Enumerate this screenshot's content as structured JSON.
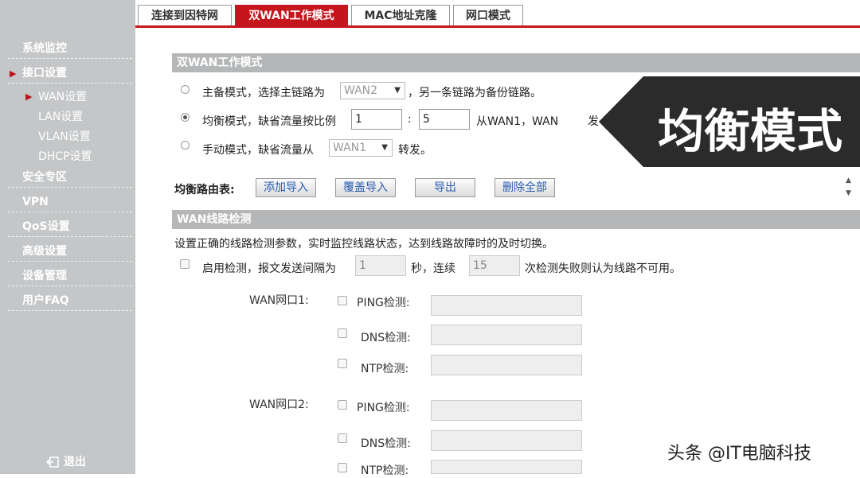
{
  "tabs": [
    {
      "label": "连接到因特网"
    },
    {
      "label": "双WAN工作模式"
    },
    {
      "label": "MAC地址克隆"
    },
    {
      "label": "网口模式"
    }
  ],
  "sidebar": {
    "items": [
      {
        "label": "系统监控"
      },
      {
        "label": "接口设置"
      },
      {
        "label": "安全专区"
      },
      {
        "label": "VPN"
      },
      {
        "label": "QoS设置"
      },
      {
        "label": "高级设置"
      },
      {
        "label": "设备管理"
      },
      {
        "label": "用户FAQ"
      }
    ],
    "subitems": [
      {
        "label": "WAN设置"
      },
      {
        "label": "LAN设置"
      },
      {
        "label": "VLAN设置"
      },
      {
        "label": "DHCP设置"
      }
    ],
    "logout": "退出"
  },
  "dual_wan": {
    "section_title": "双WAN工作模式",
    "primary_mode": {
      "prefix": "主备模式，选择主链路为",
      "select_value": "WAN2",
      "suffix": "，另一条链路为备份链路。"
    },
    "balance_mode": {
      "prefix": "均衡模式，缺省流量按比例",
      "ratio_a": "1",
      "colon": ":",
      "ratio_b": "5",
      "suffix_a": "从WAN1，WAN",
      "suffix_b": "发"
    },
    "manual_mode": {
      "prefix": "手动模式，缺省流量从",
      "select_value": "WAN1",
      "suffix": "转发。"
    },
    "route_table_label": "均衡路由表:",
    "buttons": {
      "add_import": "添加导入",
      "overwrite_import": "覆盖导入",
      "export": "导出",
      "delete_all": "删除全部"
    }
  },
  "detect": {
    "section_title": "WAN线路检测",
    "description": "设置正确的线路检测参数，实时监控线路状态，达到线路故障时的及时切换。",
    "enable": {
      "prefix": "启用检测，报文发送间隔为",
      "interval": "1",
      "mid": "秒，连续",
      "count": "15",
      "suffix": "次检测失败则认为线路不可用。"
    },
    "wan1": {
      "label": "WAN网口1:",
      "ping": "PING检测:",
      "dns": "DNS检测:",
      "ntp": "NTP检测:"
    },
    "wan2": {
      "label": "WAN网口2:",
      "ping": "PING检测:",
      "dns": "DNS检测:",
      "ntp": "NTP检测:"
    }
  },
  "overlay": {
    "text": "均衡模式",
    "color": "#2b2b2b"
  },
  "watermark": "头条 @IT电脑科技",
  "colors": {
    "accent": "#c4161c",
    "sidebar": "#c4c6c8",
    "section_bar": "#b4b6b8",
    "button_text": "#2a5db0"
  }
}
